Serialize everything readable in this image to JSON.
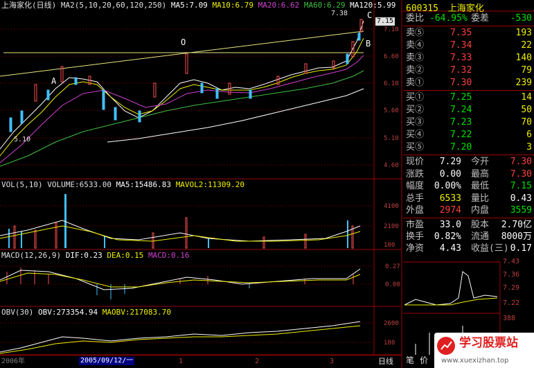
{
  "main_chart": {
    "title": "上海家化",
    "period": "(日线)",
    "ma_label": "MA2(5,10,20,60,120,250)",
    "ma5": "MA5:7.09",
    "ma10": "MA10:6.79",
    "ma20": "MA20:6.62",
    "ma60": "MA60:6.29",
    "ma120": "MA120:5.99",
    "high_label": "7.38",
    "low_label": "5.10",
    "current_price_tag": "7.15",
    "annot_A": "A",
    "annot_O": "O",
    "annot_B": "B",
    "annot_C": "C",
    "y_ticks": [
      "7.10",
      "6.60",
      "6.10",
      "5.60",
      "5.10",
      "4.60"
    ]
  },
  "volume": {
    "label": "VOL(5,10)",
    "volume": "VOLUME:6533.00",
    "ma5": "MA5:15486.83",
    "mavol2": "MAVOL2:11309.20",
    "y_ticks": [
      "4100",
      "2100",
      "100"
    ]
  },
  "macd": {
    "label": "MACD(12,26,9)",
    "dif": "DIF:0.23",
    "dea": "DEA:0.15",
    "macd": "MACD:0.16",
    "y_ticks": [
      "0.27",
      "0.08"
    ]
  },
  "obv": {
    "label": "OBV(30)",
    "obv": "OBV:273354.94",
    "maobv": "MAOBV:217083.70",
    "y_ticks": [
      "2600",
      "180"
    ]
  },
  "footer": {
    "left_label": "2006年",
    "date": "2005/09/12/一",
    "tick1": "1",
    "tick2": "2",
    "tick3": "3",
    "period_tab": "日线"
  },
  "right_panel": {
    "code": "600315",
    "name": "上海家化",
    "webi_label": "委比",
    "webi_value": "-64.95%",
    "weicha_label": "委差",
    "weicha_value": "-530",
    "sells": [
      {
        "label": "卖⑤",
        "price": "7.35",
        "vol": "193"
      },
      {
        "label": "卖④",
        "price": "7.34",
        "vol": "22"
      },
      {
        "label": "卖③",
        "price": "7.33",
        "vol": "140"
      },
      {
        "label": "卖②",
        "price": "7.32",
        "vol": "79"
      },
      {
        "label": "卖①",
        "price": "7.30",
        "vol": "239"
      }
    ],
    "buys": [
      {
        "label": "买①",
        "price": "7.25",
        "vol": "14"
      },
      {
        "label": "买②",
        "price": "7.24",
        "vol": "50"
      },
      {
        "label": "买③",
        "price": "7.23",
        "vol": "70"
      },
      {
        "label": "买④",
        "price": "7.22",
        "vol": "6"
      },
      {
        "label": "买⑤",
        "price": "7.20",
        "vol": "3"
      }
    ],
    "stats": [
      {
        "l1": "现价",
        "v1": "7.29",
        "l2": "今开",
        "v2": "7.30"
      },
      {
        "l1": "涨跌",
        "v1": "0.00",
        "l2": "最高",
        "v2": "7.30"
      },
      {
        "l1": "幅度",
        "v1": "0.00%",
        "l2": "最低",
        "v2": "7.15"
      },
      {
        "l1": "总手",
        "v1": "6533",
        "l2": "量比",
        "v2": "0.43"
      },
      {
        "l1": "外盘",
        "v1": "2974",
        "l2": "内盘",
        "v2": "3559"
      }
    ],
    "stats2": [
      {
        "l1": "市盈",
        "v1": "33.0",
        "l2": "股本",
        "v2": "2.70亿"
      },
      {
        "l1": "换手",
        "v1": "0.82%",
        "l2": "流通",
        "v2": "8000万"
      },
      {
        "l1": "净资",
        "v1": "4.43",
        "l2": "收益(三)",
        "v2": "0.17"
      }
    ],
    "mini_ticks": [
      "7.43",
      "7.36",
      "7.29",
      "7.22",
      "388"
    ],
    "bottom_tab1": "笔",
    "bottom_tab2": "价"
  },
  "watermark": {
    "title": "学习股票站",
    "url": "www.xuexizhan.top"
  }
}
